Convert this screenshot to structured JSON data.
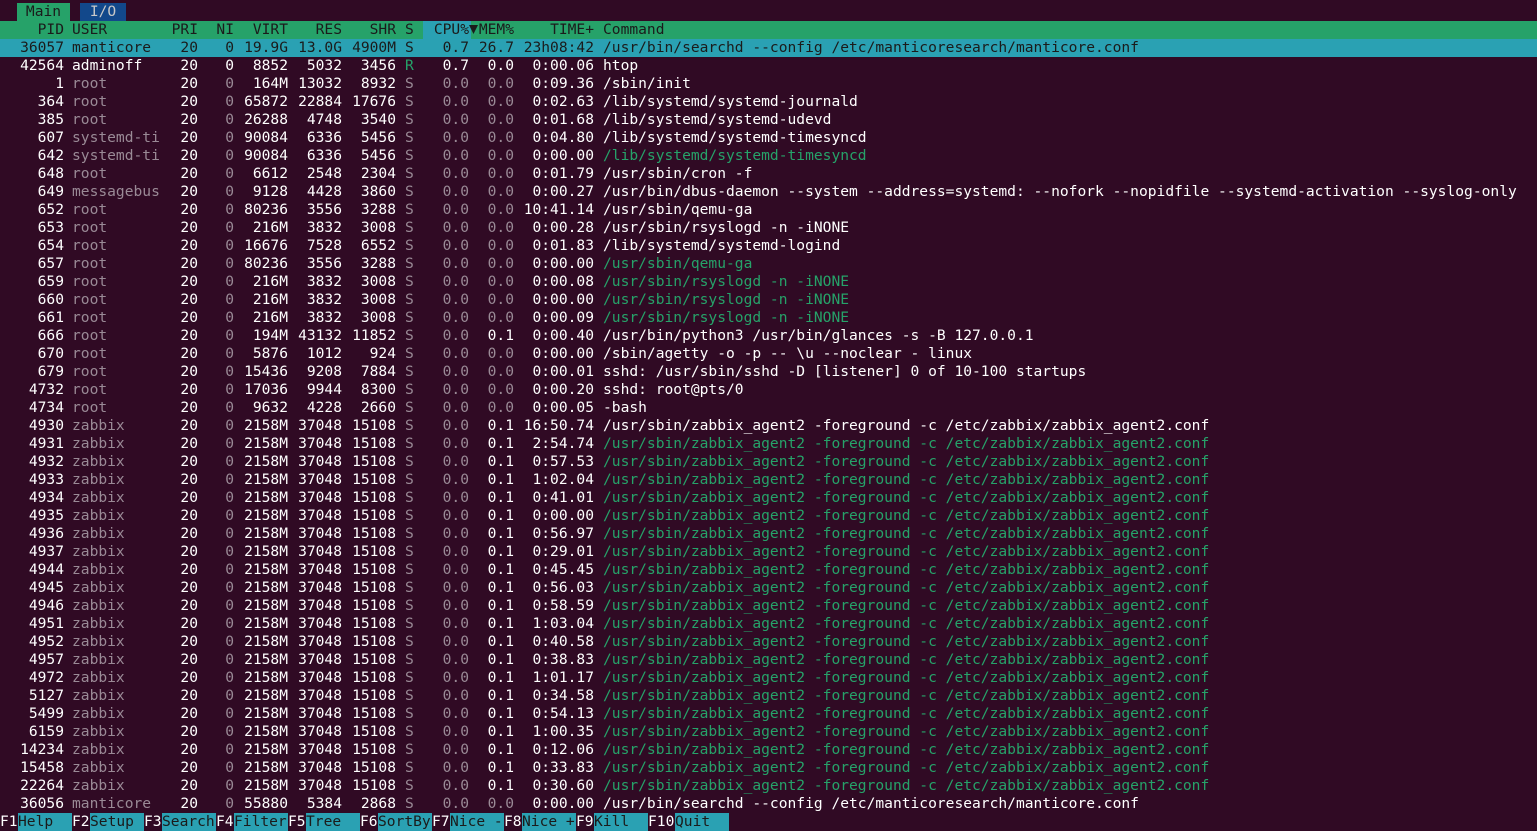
{
  "tabs": [
    {
      "label": "Main",
      "active": true
    },
    {
      "label": "I/O",
      "active": false
    }
  ],
  "columns": [
    "PID",
    "USER",
    "PRI",
    "NI",
    "VIRT",
    "RES",
    "SHR",
    "S",
    "CPU%",
    "MEM%",
    "TIME+",
    "Command"
  ],
  "sort_column": "CPU%",
  "sort_icon": "triangle-down-icon",
  "colors": {
    "background": "#300a24",
    "header": "#26a269",
    "selection": "#2aa1b3",
    "thread": "#26a269"
  },
  "processes": [
    {
      "pid": "36057",
      "user": "manticore",
      "pri": "20",
      "ni": "0",
      "virt": "19.9G",
      "res": "13.0G",
      "shr": "4900M",
      "s": "S",
      "cpu": "0.7",
      "mem": "26.7",
      "time": "23h08:42",
      "cmd": "/usr/bin/searchd --config /etc/manticoresearch/manticore.conf",
      "selected": true,
      "thread": false
    },
    {
      "pid": "42564",
      "user": "adminoff",
      "pri": "20",
      "ni": "0",
      "virt": "8852",
      "res": "5032",
      "shr": "3456",
      "s": "R",
      "cpu": "0.7",
      "mem": "0.0",
      "time": "0:00.06",
      "cmd": "htop",
      "selected": false,
      "thread": false
    },
    {
      "pid": "1",
      "user": "root",
      "pri": "20",
      "ni": "0",
      "virt": "164M",
      "res": "13032",
      "shr": "8932",
      "s": "S",
      "cpu": "0.0",
      "mem": "0.0",
      "time": "0:09.36",
      "cmd": "/sbin/init",
      "selected": false,
      "thread": false
    },
    {
      "pid": "364",
      "user": "root",
      "pri": "20",
      "ni": "0",
      "virt": "65872",
      "res": "22884",
      "shr": "17676",
      "s": "S",
      "cpu": "0.0",
      "mem": "0.0",
      "time": "0:02.63",
      "cmd": "/lib/systemd/systemd-journald",
      "selected": false,
      "thread": false
    },
    {
      "pid": "385",
      "user": "root",
      "pri": "20",
      "ni": "0",
      "virt": "26288",
      "res": "4748",
      "shr": "3540",
      "s": "S",
      "cpu": "0.0",
      "mem": "0.0",
      "time": "0:01.68",
      "cmd": "/lib/systemd/systemd-udevd",
      "selected": false,
      "thread": false
    },
    {
      "pid": "607",
      "user": "systemd-ti",
      "pri": "20",
      "ni": "0",
      "virt": "90084",
      "res": "6336",
      "shr": "5456",
      "s": "S",
      "cpu": "0.0",
      "mem": "0.0",
      "time": "0:04.80",
      "cmd": "/lib/systemd/systemd-timesyncd",
      "selected": false,
      "thread": false
    },
    {
      "pid": "642",
      "user": "systemd-ti",
      "pri": "20",
      "ni": "0",
      "virt": "90084",
      "res": "6336",
      "shr": "5456",
      "s": "S",
      "cpu": "0.0",
      "mem": "0.0",
      "time": "0:00.00",
      "cmd": "/lib/systemd/systemd-timesyncd",
      "selected": false,
      "thread": true
    },
    {
      "pid": "648",
      "user": "root",
      "pri": "20",
      "ni": "0",
      "virt": "6612",
      "res": "2548",
      "shr": "2304",
      "s": "S",
      "cpu": "0.0",
      "mem": "0.0",
      "time": "0:01.79",
      "cmd": "/usr/sbin/cron -f",
      "selected": false,
      "thread": false
    },
    {
      "pid": "649",
      "user": "messagebus",
      "pri": "20",
      "ni": "0",
      "virt": "9128",
      "res": "4428",
      "shr": "3860",
      "s": "S",
      "cpu": "0.0",
      "mem": "0.0",
      "time": "0:00.27",
      "cmd": "/usr/bin/dbus-daemon --system --address=systemd: --nofork --nopidfile --systemd-activation --syslog-only",
      "selected": false,
      "thread": false
    },
    {
      "pid": "652",
      "user": "root",
      "pri": "20",
      "ni": "0",
      "virt": "80236",
      "res": "3556",
      "shr": "3288",
      "s": "S",
      "cpu": "0.0",
      "mem": "0.0",
      "time": "10:41.14",
      "cmd": "/usr/sbin/qemu-ga",
      "selected": false,
      "thread": false
    },
    {
      "pid": "653",
      "user": "root",
      "pri": "20",
      "ni": "0",
      "virt": "216M",
      "res": "3832",
      "shr": "3008",
      "s": "S",
      "cpu": "0.0",
      "mem": "0.0",
      "time": "0:00.28",
      "cmd": "/usr/sbin/rsyslogd -n -iNONE",
      "selected": false,
      "thread": false
    },
    {
      "pid": "654",
      "user": "root",
      "pri": "20",
      "ni": "0",
      "virt": "16676",
      "res": "7528",
      "shr": "6552",
      "s": "S",
      "cpu": "0.0",
      "mem": "0.0",
      "time": "0:01.83",
      "cmd": "/lib/systemd/systemd-logind",
      "selected": false,
      "thread": false
    },
    {
      "pid": "657",
      "user": "root",
      "pri": "20",
      "ni": "0",
      "virt": "80236",
      "res": "3556",
      "shr": "3288",
      "s": "S",
      "cpu": "0.0",
      "mem": "0.0",
      "time": "0:00.00",
      "cmd": "/usr/sbin/qemu-ga",
      "selected": false,
      "thread": true
    },
    {
      "pid": "659",
      "user": "root",
      "pri": "20",
      "ni": "0",
      "virt": "216M",
      "res": "3832",
      "shr": "3008",
      "s": "S",
      "cpu": "0.0",
      "mem": "0.0",
      "time": "0:00.08",
      "cmd": "/usr/sbin/rsyslogd -n -iNONE",
      "selected": false,
      "thread": true
    },
    {
      "pid": "660",
      "user": "root",
      "pri": "20",
      "ni": "0",
      "virt": "216M",
      "res": "3832",
      "shr": "3008",
      "s": "S",
      "cpu": "0.0",
      "mem": "0.0",
      "time": "0:00.00",
      "cmd": "/usr/sbin/rsyslogd -n -iNONE",
      "selected": false,
      "thread": true
    },
    {
      "pid": "661",
      "user": "root",
      "pri": "20",
      "ni": "0",
      "virt": "216M",
      "res": "3832",
      "shr": "3008",
      "s": "S",
      "cpu": "0.0",
      "mem": "0.0",
      "time": "0:00.09",
      "cmd": "/usr/sbin/rsyslogd -n -iNONE",
      "selected": false,
      "thread": true
    },
    {
      "pid": "666",
      "user": "root",
      "pri": "20",
      "ni": "0",
      "virt": "194M",
      "res": "43132",
      "shr": "11852",
      "s": "S",
      "cpu": "0.0",
      "mem": "0.1",
      "time": "0:00.40",
      "cmd": "/usr/bin/python3 /usr/bin/glances -s -B 127.0.0.1",
      "selected": false,
      "thread": false
    },
    {
      "pid": "670",
      "user": "root",
      "pri": "20",
      "ni": "0",
      "virt": "5876",
      "res": "1012",
      "shr": "924",
      "s": "S",
      "cpu": "0.0",
      "mem": "0.0",
      "time": "0:00.00",
      "cmd": "/sbin/agetty -o -p -- \\u --noclear - linux",
      "selected": false,
      "thread": false
    },
    {
      "pid": "679",
      "user": "root",
      "pri": "20",
      "ni": "0",
      "virt": "15436",
      "res": "9208",
      "shr": "7884",
      "s": "S",
      "cpu": "0.0",
      "mem": "0.0",
      "time": "0:00.01",
      "cmd": "sshd: /usr/sbin/sshd -D [listener] 0 of 10-100 startups",
      "selected": false,
      "thread": false
    },
    {
      "pid": "4732",
      "user": "root",
      "pri": "20",
      "ni": "0",
      "virt": "17036",
      "res": "9944",
      "shr": "8300",
      "s": "S",
      "cpu": "0.0",
      "mem": "0.0",
      "time": "0:00.20",
      "cmd": "sshd: root@pts/0",
      "selected": false,
      "thread": false
    },
    {
      "pid": "4734",
      "user": "root",
      "pri": "20",
      "ni": "0",
      "virt": "9632",
      "res": "4228",
      "shr": "2660",
      "s": "S",
      "cpu": "0.0",
      "mem": "0.0",
      "time": "0:00.05",
      "cmd": "-bash",
      "selected": false,
      "thread": false
    },
    {
      "pid": "4930",
      "user": "zabbix",
      "pri": "20",
      "ni": "0",
      "virt": "2158M",
      "res": "37048",
      "shr": "15108",
      "s": "S",
      "cpu": "0.0",
      "mem": "0.1",
      "time": "16:50.74",
      "cmd": "/usr/sbin/zabbix_agent2 -foreground -c /etc/zabbix/zabbix_agent2.conf",
      "selected": false,
      "thread": false
    },
    {
      "pid": "4931",
      "user": "zabbix",
      "pri": "20",
      "ni": "0",
      "virt": "2158M",
      "res": "37048",
      "shr": "15108",
      "s": "S",
      "cpu": "0.0",
      "mem": "0.1",
      "time": "2:54.74",
      "cmd": "/usr/sbin/zabbix_agent2 -foreground -c /etc/zabbix/zabbix_agent2.conf",
      "selected": false,
      "thread": true
    },
    {
      "pid": "4932",
      "user": "zabbix",
      "pri": "20",
      "ni": "0",
      "virt": "2158M",
      "res": "37048",
      "shr": "15108",
      "s": "S",
      "cpu": "0.0",
      "mem": "0.1",
      "time": "0:57.53",
      "cmd": "/usr/sbin/zabbix_agent2 -foreground -c /etc/zabbix/zabbix_agent2.conf",
      "selected": false,
      "thread": true
    },
    {
      "pid": "4933",
      "user": "zabbix",
      "pri": "20",
      "ni": "0",
      "virt": "2158M",
      "res": "37048",
      "shr": "15108",
      "s": "S",
      "cpu": "0.0",
      "mem": "0.1",
      "time": "1:02.04",
      "cmd": "/usr/sbin/zabbix_agent2 -foreground -c /etc/zabbix/zabbix_agent2.conf",
      "selected": false,
      "thread": true
    },
    {
      "pid": "4934",
      "user": "zabbix",
      "pri": "20",
      "ni": "0",
      "virt": "2158M",
      "res": "37048",
      "shr": "15108",
      "s": "S",
      "cpu": "0.0",
      "mem": "0.1",
      "time": "0:41.01",
      "cmd": "/usr/sbin/zabbix_agent2 -foreground -c /etc/zabbix/zabbix_agent2.conf",
      "selected": false,
      "thread": true
    },
    {
      "pid": "4935",
      "user": "zabbix",
      "pri": "20",
      "ni": "0",
      "virt": "2158M",
      "res": "37048",
      "shr": "15108",
      "s": "S",
      "cpu": "0.0",
      "mem": "0.1",
      "time": "0:00.00",
      "cmd": "/usr/sbin/zabbix_agent2 -foreground -c /etc/zabbix/zabbix_agent2.conf",
      "selected": false,
      "thread": true
    },
    {
      "pid": "4936",
      "user": "zabbix",
      "pri": "20",
      "ni": "0",
      "virt": "2158M",
      "res": "37048",
      "shr": "15108",
      "s": "S",
      "cpu": "0.0",
      "mem": "0.1",
      "time": "0:56.97",
      "cmd": "/usr/sbin/zabbix_agent2 -foreground -c /etc/zabbix/zabbix_agent2.conf",
      "selected": false,
      "thread": true
    },
    {
      "pid": "4937",
      "user": "zabbix",
      "pri": "20",
      "ni": "0",
      "virt": "2158M",
      "res": "37048",
      "shr": "15108",
      "s": "S",
      "cpu": "0.0",
      "mem": "0.1",
      "time": "0:29.01",
      "cmd": "/usr/sbin/zabbix_agent2 -foreground -c /etc/zabbix/zabbix_agent2.conf",
      "selected": false,
      "thread": true
    },
    {
      "pid": "4944",
      "user": "zabbix",
      "pri": "20",
      "ni": "0",
      "virt": "2158M",
      "res": "37048",
      "shr": "15108",
      "s": "S",
      "cpu": "0.0",
      "mem": "0.1",
      "time": "0:45.45",
      "cmd": "/usr/sbin/zabbix_agent2 -foreground -c /etc/zabbix/zabbix_agent2.conf",
      "selected": false,
      "thread": true
    },
    {
      "pid": "4945",
      "user": "zabbix",
      "pri": "20",
      "ni": "0",
      "virt": "2158M",
      "res": "37048",
      "shr": "15108",
      "s": "S",
      "cpu": "0.0",
      "mem": "0.1",
      "time": "0:56.03",
      "cmd": "/usr/sbin/zabbix_agent2 -foreground -c /etc/zabbix/zabbix_agent2.conf",
      "selected": false,
      "thread": true
    },
    {
      "pid": "4946",
      "user": "zabbix",
      "pri": "20",
      "ni": "0",
      "virt": "2158M",
      "res": "37048",
      "shr": "15108",
      "s": "S",
      "cpu": "0.0",
      "mem": "0.1",
      "time": "0:58.59",
      "cmd": "/usr/sbin/zabbix_agent2 -foreground -c /etc/zabbix/zabbix_agent2.conf",
      "selected": false,
      "thread": true
    },
    {
      "pid": "4951",
      "user": "zabbix",
      "pri": "20",
      "ni": "0",
      "virt": "2158M",
      "res": "37048",
      "shr": "15108",
      "s": "S",
      "cpu": "0.0",
      "mem": "0.1",
      "time": "1:03.04",
      "cmd": "/usr/sbin/zabbix_agent2 -foreground -c /etc/zabbix/zabbix_agent2.conf",
      "selected": false,
      "thread": true
    },
    {
      "pid": "4952",
      "user": "zabbix",
      "pri": "20",
      "ni": "0",
      "virt": "2158M",
      "res": "37048",
      "shr": "15108",
      "s": "S",
      "cpu": "0.0",
      "mem": "0.1",
      "time": "0:40.58",
      "cmd": "/usr/sbin/zabbix_agent2 -foreground -c /etc/zabbix/zabbix_agent2.conf",
      "selected": false,
      "thread": true
    },
    {
      "pid": "4957",
      "user": "zabbix",
      "pri": "20",
      "ni": "0",
      "virt": "2158M",
      "res": "37048",
      "shr": "15108",
      "s": "S",
      "cpu": "0.0",
      "mem": "0.1",
      "time": "0:38.83",
      "cmd": "/usr/sbin/zabbix_agent2 -foreground -c /etc/zabbix/zabbix_agent2.conf",
      "selected": false,
      "thread": true
    },
    {
      "pid": "4972",
      "user": "zabbix",
      "pri": "20",
      "ni": "0",
      "virt": "2158M",
      "res": "37048",
      "shr": "15108",
      "s": "S",
      "cpu": "0.0",
      "mem": "0.1",
      "time": "1:01.17",
      "cmd": "/usr/sbin/zabbix_agent2 -foreground -c /etc/zabbix/zabbix_agent2.conf",
      "selected": false,
      "thread": true
    },
    {
      "pid": "5127",
      "user": "zabbix",
      "pri": "20",
      "ni": "0",
      "virt": "2158M",
      "res": "37048",
      "shr": "15108",
      "s": "S",
      "cpu": "0.0",
      "mem": "0.1",
      "time": "0:34.58",
      "cmd": "/usr/sbin/zabbix_agent2 -foreground -c /etc/zabbix/zabbix_agent2.conf",
      "selected": false,
      "thread": true
    },
    {
      "pid": "5499",
      "user": "zabbix",
      "pri": "20",
      "ni": "0",
      "virt": "2158M",
      "res": "37048",
      "shr": "15108",
      "s": "S",
      "cpu": "0.0",
      "mem": "0.1",
      "time": "0:54.13",
      "cmd": "/usr/sbin/zabbix_agent2 -foreground -c /etc/zabbix/zabbix_agent2.conf",
      "selected": false,
      "thread": true
    },
    {
      "pid": "6159",
      "user": "zabbix",
      "pri": "20",
      "ni": "0",
      "virt": "2158M",
      "res": "37048",
      "shr": "15108",
      "s": "S",
      "cpu": "0.0",
      "mem": "0.1",
      "time": "1:00.35",
      "cmd": "/usr/sbin/zabbix_agent2 -foreground -c /etc/zabbix/zabbix_agent2.conf",
      "selected": false,
      "thread": true
    },
    {
      "pid": "14234",
      "user": "zabbix",
      "pri": "20",
      "ni": "0",
      "virt": "2158M",
      "res": "37048",
      "shr": "15108",
      "s": "S",
      "cpu": "0.0",
      "mem": "0.1",
      "time": "0:12.06",
      "cmd": "/usr/sbin/zabbix_agent2 -foreground -c /etc/zabbix/zabbix_agent2.conf",
      "selected": false,
      "thread": true
    },
    {
      "pid": "15458",
      "user": "zabbix",
      "pri": "20",
      "ni": "0",
      "virt": "2158M",
      "res": "37048",
      "shr": "15108",
      "s": "S",
      "cpu": "0.0",
      "mem": "0.1",
      "time": "0:33.83",
      "cmd": "/usr/sbin/zabbix_agent2 -foreground -c /etc/zabbix/zabbix_agent2.conf",
      "selected": false,
      "thread": true
    },
    {
      "pid": "22264",
      "user": "zabbix",
      "pri": "20",
      "ni": "0",
      "virt": "2158M",
      "res": "37048",
      "shr": "15108",
      "s": "S",
      "cpu": "0.0",
      "mem": "0.1",
      "time": "0:30.60",
      "cmd": "/usr/sbin/zabbix_agent2 -foreground -c /etc/zabbix/zabbix_agent2.conf",
      "selected": false,
      "thread": true
    },
    {
      "pid": "36056",
      "user": "manticore",
      "pri": "20",
      "ni": "0",
      "virt": "55880",
      "res": "5384",
      "shr": "2868",
      "s": "S",
      "cpu": "0.0",
      "mem": "0.0",
      "time": "0:00.00",
      "cmd": "/usr/bin/searchd --config /etc/manticoresearch/manticore.conf",
      "selected": false,
      "thread": false
    }
  ],
  "function_keys": [
    {
      "key": "F1",
      "label": "Help"
    },
    {
      "key": "F2",
      "label": "Setup"
    },
    {
      "key": "F3",
      "label": "Search"
    },
    {
      "key": "F4",
      "label": "Filter"
    },
    {
      "key": "F5",
      "label": "Tree"
    },
    {
      "key": "F6",
      "label": "SortBy"
    },
    {
      "key": "F7",
      "label": "Nice -"
    },
    {
      "key": "F8",
      "label": "Nice +"
    },
    {
      "key": "F9",
      "label": "Kill"
    },
    {
      "key": "F10",
      "label": "Quit"
    }
  ]
}
